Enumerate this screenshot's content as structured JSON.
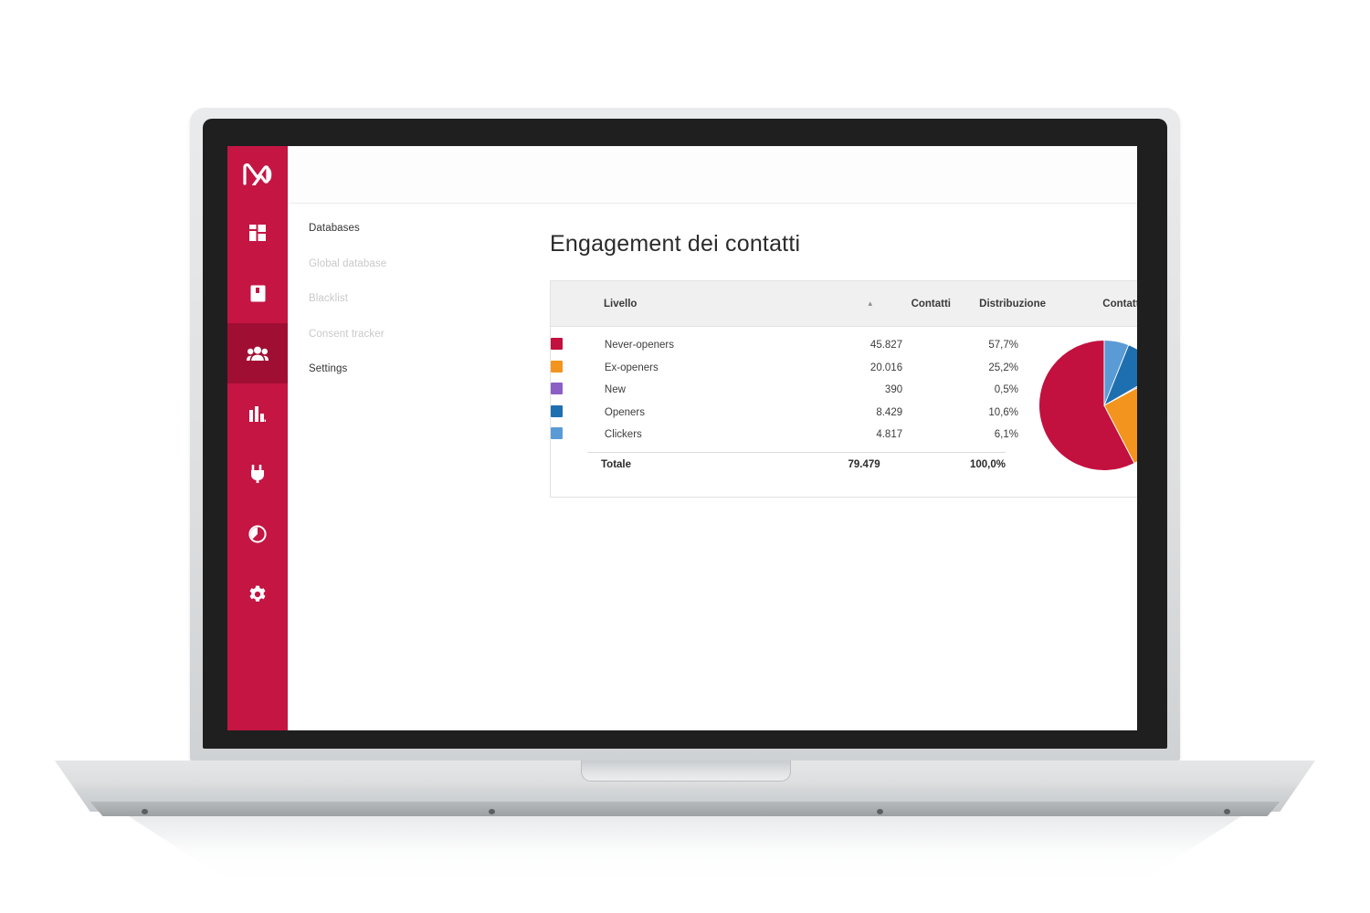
{
  "app": {
    "brand_logo": "mailup-m-logo"
  },
  "icon_rail": {
    "items": [
      {
        "name": "dashboard-icon",
        "active": false
      },
      {
        "name": "map-icon",
        "active": false
      },
      {
        "name": "contacts-people-icon",
        "active": true
      },
      {
        "name": "statistics-bar-chart-icon",
        "active": false
      },
      {
        "name": "plug-integrations-icon",
        "active": false
      },
      {
        "name": "gauge-deliverability-icon",
        "active": false
      },
      {
        "name": "settings-gear-icon",
        "active": false
      }
    ]
  },
  "secondary_nav": {
    "items": [
      {
        "label": "Databases",
        "emphasis": "strong"
      },
      {
        "label": "Global database",
        "emphasis": "muted"
      },
      {
        "label": "Blacklist",
        "emphasis": "muted"
      },
      {
        "label": "Consent tracker",
        "emphasis": "muted"
      },
      {
        "label": "Settings",
        "emphasis": "strong"
      }
    ]
  },
  "page": {
    "title": "Engagement dei contatti"
  },
  "table": {
    "headers": {
      "livello": "Livello",
      "sort_caret": "▴",
      "contatti": "Contatti",
      "distribuzione": "Distribuzione",
      "contatti_chart": "Contatti"
    },
    "rows": [
      {
        "color": "#c2103f",
        "livello": "Never-openers",
        "contatti": "45.827",
        "distribuzione": "57,7%"
      },
      {
        "color": "#f2941e",
        "livello": "Ex-openers",
        "contatti": "20.016",
        "distribuzione": "25,2%"
      },
      {
        "color": "#8b5fc4",
        "livello": "New",
        "contatti": "390",
        "distribuzione": "0,5%"
      },
      {
        "color": "#1e6fb0",
        "livello": "Openers",
        "contatti": "8.429",
        "distribuzione": "10,6%"
      },
      {
        "color": "#5b9bd5",
        "livello": "Clickers",
        "contatti": "4.817",
        "distribuzione": "6,1%"
      }
    ],
    "total": {
      "label": "Totale",
      "contatti": "79.479",
      "distribuzione": "100,0%"
    }
  },
  "chart_data": {
    "type": "pie",
    "title": "Contatti",
    "labels": [
      "Never-openers",
      "Ex-openers",
      "New",
      "Openers",
      "Clickers"
    ],
    "values": [
      45827,
      20016,
      390,
      8429,
      4817
    ],
    "percentages": [
      57.7,
      25.2,
      0.5,
      10.6,
      6.1
    ],
    "colors": [
      "#c2103f",
      "#f2941e",
      "#8b5fc4",
      "#1e6fb0",
      "#5b9bd5"
    ],
    "total": 79479,
    "start_angle_deg": 0,
    "direction": "counterclockwise",
    "legend_position": "left-table"
  },
  "theme": {
    "brand_crimson": "#c41543",
    "brand_crimson_active": "#a00f33"
  }
}
